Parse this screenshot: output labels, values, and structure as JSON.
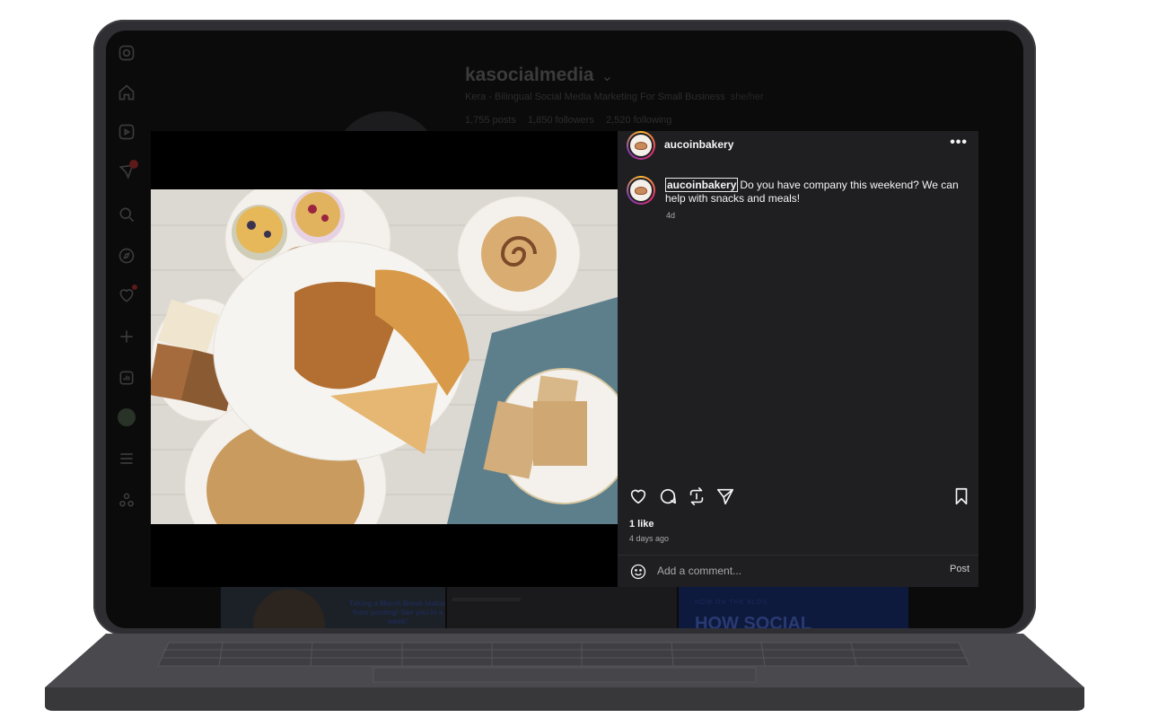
{
  "profile": {
    "username": "kasocialmedia",
    "chevron": "⌄",
    "bio": "Kera - Bilingual Social Media Marketing For Small Business",
    "pronouns": "she/her",
    "stats": [
      "1,755 posts",
      "1,850 followers",
      "2,520 following"
    ]
  },
  "sidebar_icons": [
    "instagram-icon",
    "home-icon",
    "reels-icon",
    "messages-icon",
    "search-icon",
    "explore-icon",
    "notifications-icon",
    "create-icon",
    "dashboard-icon",
    "profile-avatar",
    "menu-icon",
    "threads-icon"
  ],
  "background_tiles": {
    "tile1_text": "Taking a March Break hiatus from posting! See you in a week!",
    "tile3_label": "NOW ON THE BLOG",
    "tile3_title": "HOW SOCIAL"
  },
  "post": {
    "username": "aucoinbakery",
    "more_label": "•••",
    "caption_user": "aucoinbakery",
    "caption_text": "Do you have company this weekend? We can help with snacks and meals!",
    "caption_time": "4d",
    "likes": "1 like",
    "posted": "4 days ago",
    "comment_placeholder": "Add a comment...",
    "post_button": "Post"
  },
  "colors": {
    "modal_bg": "#1f1f22",
    "text": "#f5f5f5",
    "muted": "#a8a8a8",
    "story_ring": [
      "#fdbb2d",
      "#e1306c",
      "#833ab4"
    ],
    "laptop": "#2f2f33"
  }
}
